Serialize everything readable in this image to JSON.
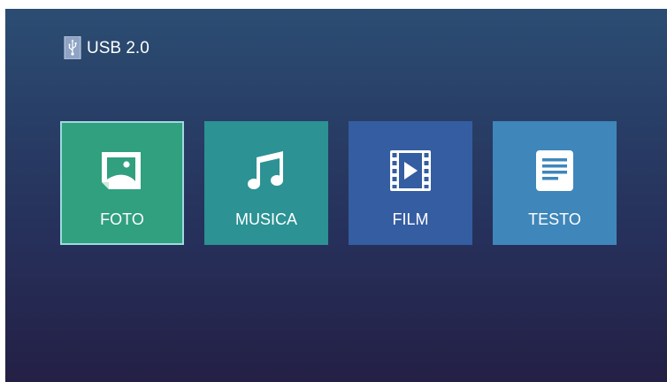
{
  "source": {
    "label": "USB 2.0",
    "icon": "usb-drive-icon"
  },
  "menu": {
    "selected_index": 0,
    "items": [
      {
        "label": "FOTO",
        "icon": "photo-icon",
        "color": "#30a07f"
      },
      {
        "label": "MUSICA",
        "icon": "music-note-icon",
        "color": "#2c9294"
      },
      {
        "label": "FILM",
        "icon": "film-icon",
        "color": "#355da1"
      },
      {
        "label": "TESTO",
        "icon": "text-document-icon",
        "color": "#3f86ba"
      }
    ]
  },
  "colors": {
    "selected_border": "#9fd9df",
    "icon_fill": "#ffffff"
  }
}
